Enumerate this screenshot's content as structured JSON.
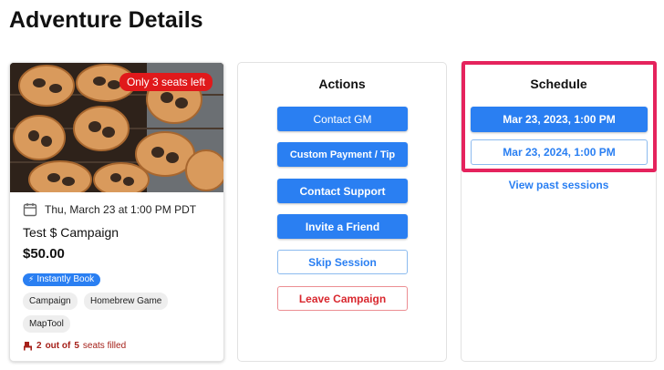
{
  "page": {
    "title": "Adventure Details"
  },
  "game_card": {
    "seats_badge": "Only 3 seats left",
    "date": "Thu, March 23 at 1:00 PM PDT",
    "campaign_name": "Test $ Campaign",
    "price": "$50.00",
    "instant_book": "Instantly Book",
    "tags": [
      "Campaign",
      "Homebrew Game",
      "MapTool"
    ],
    "seats_filled": {
      "current": "2",
      "joiner1": "out of",
      "total": "5",
      "suffix": "seats filled"
    },
    "icons": {
      "calendar": "calendar-icon",
      "chair": "chair-icon",
      "bolt": "bolt-icon"
    },
    "colors": {
      "badge": "#e0191b",
      "seats_text": "#a52019",
      "chip": "#2a7ff2"
    }
  },
  "actions": {
    "title": "Actions",
    "contact_gm": "Contact GM",
    "custom_payment": "Custom Payment / Tip",
    "contact_support": "Contact Support",
    "invite_friend": "Invite a Friend",
    "skip_session": "Skip Session",
    "leave_campaign": "Leave Campaign"
  },
  "schedule": {
    "title": "Schedule",
    "sessions": [
      "Mar 23, 2023, 1:00 PM",
      "Mar 23, 2024, 1:00 PM"
    ],
    "past_link": "View past sessions"
  },
  "colors": {
    "primary": "#2a7ff2",
    "danger": "#d9282f",
    "highlight": "#e5235d"
  }
}
